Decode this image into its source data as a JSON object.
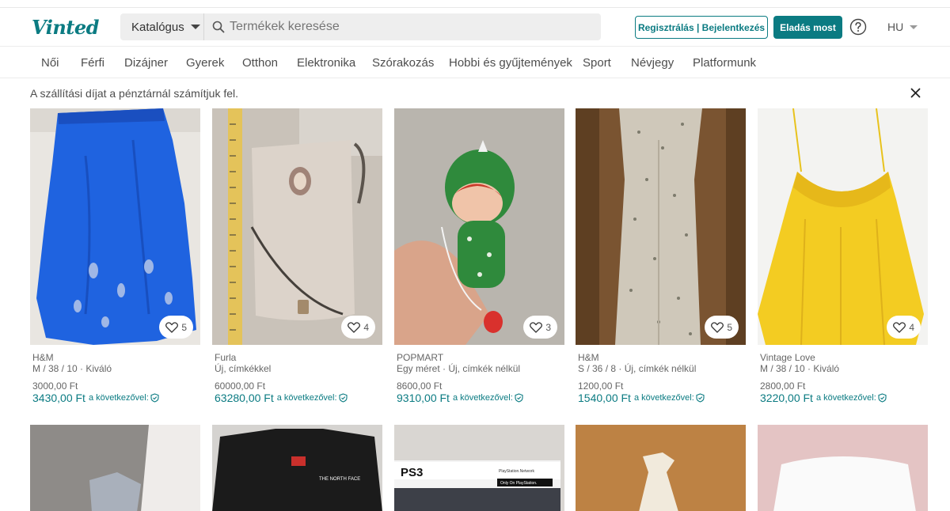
{
  "header": {
    "logo": "Vinted",
    "catalog_label": "Katalógus",
    "search_placeholder": "Termékek keresése",
    "auth_label": "Regisztrálás | Bejelentkezés",
    "sell_label": "Eladás most",
    "language": "HU"
  },
  "nav": {
    "items": [
      "Női",
      "Férfi",
      "Dizájner",
      "Gyerek",
      "Otthon",
      "Elektronika",
      "Szórakozás",
      "Hobbi és gyűjtemények",
      "Sport",
      "Névjegy",
      "Platformunk"
    ]
  },
  "notice": "A szállítási díjat a pénztárnál számítjuk fel.",
  "colors": {
    "accent": "#0b7b82"
  },
  "price_suffix": "a következővel:",
  "products": [
    {
      "brand": "H&M",
      "details": "M / 38 / 10 · Kiváló",
      "price": "3000,00 Ft",
      "total": "3430,00 Ft",
      "likes": "5"
    },
    {
      "brand": "Furla",
      "details": "Új, címkékkel",
      "price": "60000,00 Ft",
      "total": "63280,00 Ft",
      "likes": "4"
    },
    {
      "brand": "POPMART",
      "details": "Egy méret · Új, címkék nélkül",
      "price": "8600,00 Ft",
      "total": "9310,00 Ft",
      "likes": "3"
    },
    {
      "brand": "H&M",
      "details": "S / 36 / 8 · Új, címkék nélkül",
      "price": "1200,00 Ft",
      "total": "1540,00 Ft",
      "likes": "5"
    },
    {
      "brand": "Vintage Love",
      "details": "M / 38 / 10 · Kiváló",
      "price": "2800,00 Ft",
      "total": "3220,00 Ft",
      "likes": "4"
    }
  ],
  "second_row": {
    "ps3_label": "PS3",
    "psn_label": "PlayStation.Network",
    "ps_only_label": "Only On PlayStation.",
    "tnf_label": "THE NORTH FACE"
  }
}
